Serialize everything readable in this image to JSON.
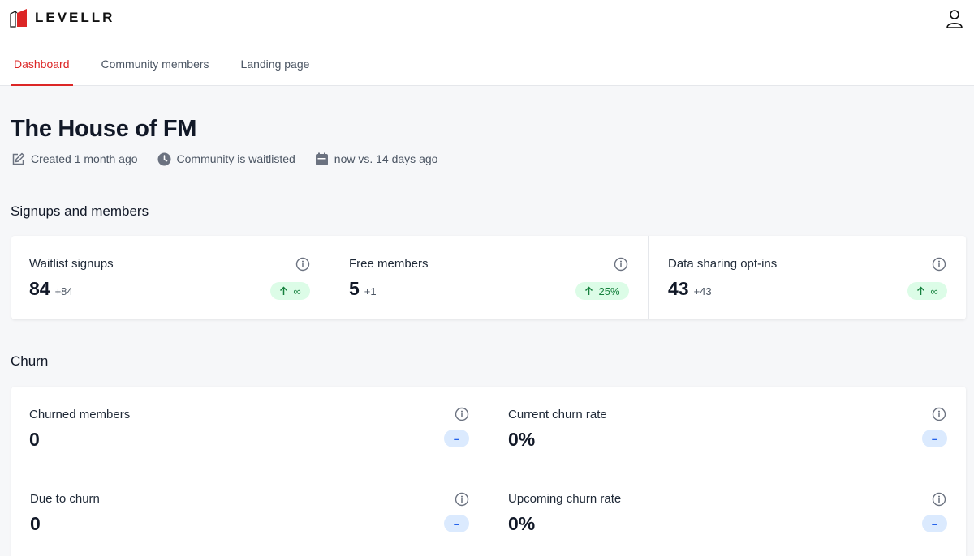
{
  "app": {
    "brand": "LEVELLR"
  },
  "nav": {
    "tabs": [
      {
        "label": "Dashboard",
        "active": true
      },
      {
        "label": "Community members",
        "active": false
      },
      {
        "label": "Landing page",
        "active": false
      }
    ]
  },
  "page": {
    "title": "The House of FM",
    "meta": {
      "created": "Created 1 month ago",
      "status": "Community is waitlisted",
      "range": "now vs. 14 days ago"
    }
  },
  "signups": {
    "title": "Signups and members",
    "cards": [
      {
        "label": "Waitlist signups",
        "value": "84",
        "delta": "+84",
        "trend": "∞"
      },
      {
        "label": "Free members",
        "value": "5",
        "delta": "+1",
        "trend": "25%"
      },
      {
        "label": "Data sharing opt-ins",
        "value": "43",
        "delta": "+43",
        "trend": "∞"
      }
    ]
  },
  "churn": {
    "title": "Churn",
    "cards": [
      {
        "label": "Churned members",
        "value": "0",
        "trend": "–"
      },
      {
        "label": "Current churn rate",
        "value": "0%",
        "trend": "–"
      },
      {
        "label": "Due to churn",
        "value": "0",
        "trend": "–"
      },
      {
        "label": "Upcoming churn rate",
        "value": "0%",
        "trend": "–"
      }
    ]
  },
  "colors": {
    "accent": "#dc2626",
    "positive_bg": "#dcfce7",
    "positive_fg": "#15803d",
    "neutral_bg": "#dbeafe",
    "neutral_fg": "#2563eb"
  }
}
